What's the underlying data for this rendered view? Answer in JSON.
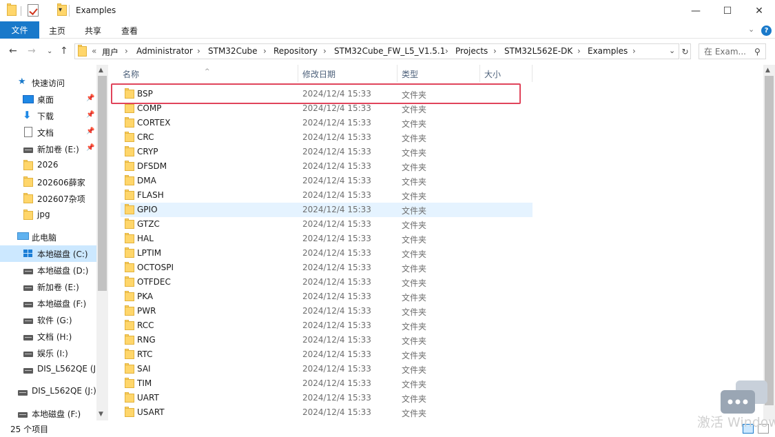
{
  "window": {
    "title": "Examples",
    "minimize": "—",
    "maximize": "☐",
    "close": "✕"
  },
  "ribbon": {
    "tabs": [
      "文件",
      "主页",
      "共享",
      "查看"
    ],
    "help": "?"
  },
  "address": {
    "overflow": "«",
    "crumbs": [
      "用户",
      "Administrator",
      "STM32Cube",
      "Repository",
      "STM32Cube_FW_L5_V1.5.1",
      "Projects",
      "STM32L562E-DK",
      "Examples"
    ],
    "search_placeholder": "在 Exam..."
  },
  "nav_pane": {
    "items": [
      {
        "label": "快速访问",
        "icon": "star-icon"
      },
      {
        "label": "桌面",
        "icon": "desktop-icon",
        "pinned": true
      },
      {
        "label": "下载",
        "icon": "download-icon",
        "pinned": true
      },
      {
        "label": "文档",
        "icon": "document-icon",
        "pinned": true
      },
      {
        "label": "新加卷 (E:)",
        "icon": "drive-icon",
        "pinned": true
      },
      {
        "label": "2026",
        "icon": "folder-icon"
      },
      {
        "label": "202606薛家",
        "icon": "folder-icon"
      },
      {
        "label": "202607杂项",
        "icon": "folder-icon"
      },
      {
        "label": "jpg",
        "icon": "folder-icon"
      },
      {
        "label": "此电脑",
        "icon": "computer-icon"
      },
      {
        "label": "本地磁盘 (C:)",
        "icon": "system-drive-icon",
        "selected": true
      },
      {
        "label": "本地磁盘 (D:)",
        "icon": "drive-icon"
      },
      {
        "label": "新加卷 (E:)",
        "icon": "drive-icon"
      },
      {
        "label": "本地磁盘 (F:)",
        "icon": "drive-icon"
      },
      {
        "label": "软件 (G:)",
        "icon": "drive-icon"
      },
      {
        "label": "文档 (H:)",
        "icon": "drive-icon"
      },
      {
        "label": "娱乐 (I:)",
        "icon": "drive-icon"
      },
      {
        "label": "DIS_L562QE (J:",
        "icon": "drive-icon"
      },
      {
        "label": "DIS_L562QE (J:)",
        "icon": "drive-icon"
      },
      {
        "label": "本地磁盘 (F:)",
        "icon": "drive-icon"
      }
    ]
  },
  "file_list": {
    "columns": [
      "名称",
      "修改日期",
      "类型",
      "大小"
    ],
    "rows": [
      {
        "name": "BSP",
        "date": "2024/12/4 15:33",
        "type": "文件夹"
      },
      {
        "name": "COMP",
        "date": "2024/12/4 15:33",
        "type": "文件夹"
      },
      {
        "name": "CORTEX",
        "date": "2024/12/4 15:33",
        "type": "文件夹"
      },
      {
        "name": "CRC",
        "date": "2024/12/4 15:33",
        "type": "文件夹"
      },
      {
        "name": "CRYP",
        "date": "2024/12/4 15:33",
        "type": "文件夹"
      },
      {
        "name": "DFSDM",
        "date": "2024/12/4 15:33",
        "type": "文件夹"
      },
      {
        "name": "DMA",
        "date": "2024/12/4 15:33",
        "type": "文件夹"
      },
      {
        "name": "FLASH",
        "date": "2024/12/4 15:33",
        "type": "文件夹"
      },
      {
        "name": "GPIO",
        "date": "2024/12/4 15:33",
        "type": "文件夹"
      },
      {
        "name": "GTZC",
        "date": "2024/12/4 15:33",
        "type": "文件夹"
      },
      {
        "name": "HAL",
        "date": "2024/12/4 15:33",
        "type": "文件夹"
      },
      {
        "name": "LPTIM",
        "date": "2024/12/4 15:33",
        "type": "文件夹"
      },
      {
        "name": "OCTOSPI",
        "date": "2024/12/4 15:33",
        "type": "文件夹"
      },
      {
        "name": "OTFDEC",
        "date": "2024/12/4 15:33",
        "type": "文件夹"
      },
      {
        "name": "PKA",
        "date": "2024/12/4 15:33",
        "type": "文件夹"
      },
      {
        "name": "PWR",
        "date": "2024/12/4 15:33",
        "type": "文件夹"
      },
      {
        "name": "RCC",
        "date": "2024/12/4 15:33",
        "type": "文件夹"
      },
      {
        "name": "RNG",
        "date": "2024/12/4 15:33",
        "type": "文件夹"
      },
      {
        "name": "RTC",
        "date": "2024/12/4 15:33",
        "type": "文件夹"
      },
      {
        "name": "SAI",
        "date": "2024/12/4 15:33",
        "type": "文件夹"
      },
      {
        "name": "TIM",
        "date": "2024/12/4 15:33",
        "type": "文件夹"
      },
      {
        "name": "UART",
        "date": "2024/12/4 15:33",
        "type": "文件夹"
      },
      {
        "name": "USART",
        "date": "2024/12/4 15:33",
        "type": "文件夹"
      }
    ],
    "hovered_row": "GPIO",
    "highlighted_row": "BSP"
  },
  "status": {
    "item_count": "25 个项目"
  },
  "watermark": {
    "text": "激活 Windows"
  },
  "colors": {
    "accent": "#1979ca",
    "selection": "#cce8ff",
    "hover": "#e5f3ff",
    "highlight_box": "#e0435a",
    "folder": "#ffd66b"
  }
}
